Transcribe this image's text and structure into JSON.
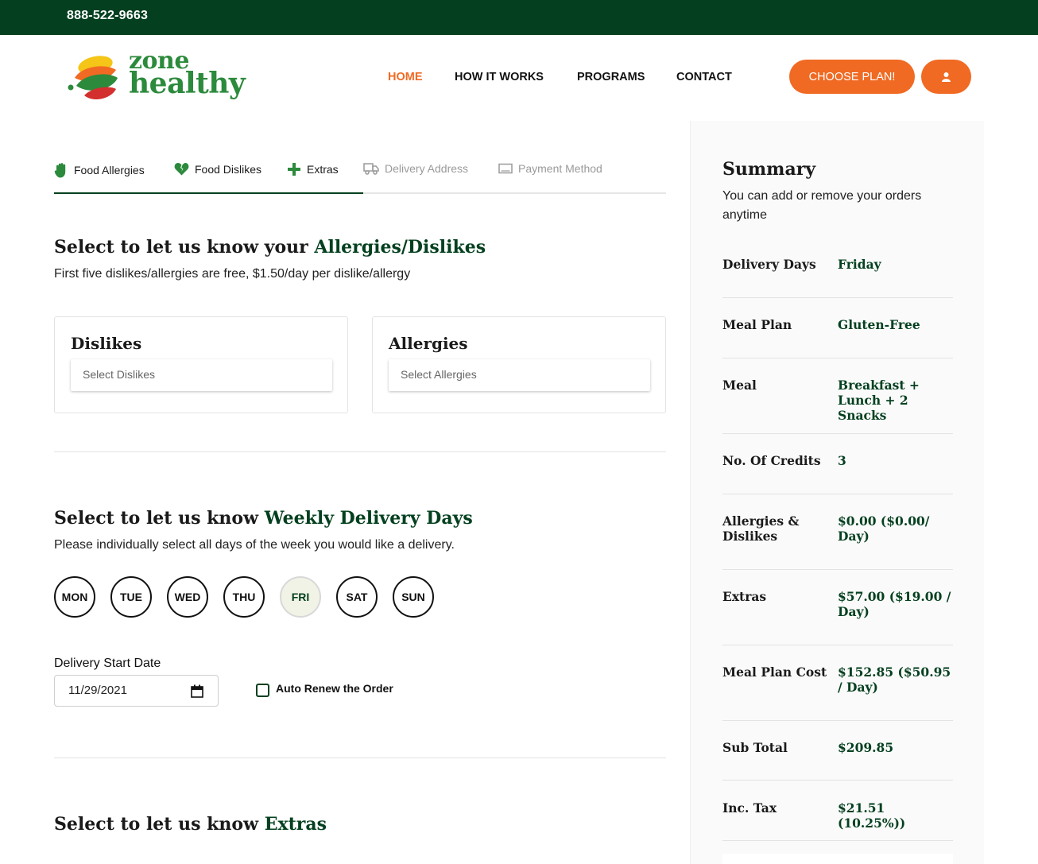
{
  "topbar": {
    "phone": "888-522-9663"
  },
  "header": {
    "logo": {
      "line1": "zone",
      "line2": "healthy"
    },
    "nav": [
      {
        "label": "HOME",
        "active": true
      },
      {
        "label": "HOW IT WORKS",
        "active": false
      },
      {
        "label": "PROGRAMS",
        "active": false
      },
      {
        "label": "CONTACT",
        "active": false
      }
    ],
    "cta_label": "CHOOSE PLAN!",
    "user_icon": "user-icon"
  },
  "colors": {
    "brand_dark": "#04401f",
    "accent": "#f06a23",
    "logo_green": "#2c8a3c"
  },
  "tabs": [
    {
      "label": "Food Allergies",
      "icon": "hand-icon",
      "enabled": true
    },
    {
      "label": "Food Dislikes",
      "icon": "broken-heart-icon",
      "enabled": true
    },
    {
      "label": "Extras",
      "icon": "plus-icon",
      "enabled": true
    },
    {
      "label": "Delivery Address",
      "icon": "truck-icon",
      "enabled": false
    },
    {
      "label": "Payment Method",
      "icon": "card-icon",
      "enabled": false
    }
  ],
  "allergies_section": {
    "title_prefix": "Select to let us know your ",
    "title_highlight": "Allergies/Dislikes",
    "subtitle": "First five dislikes/allergies are free, $1.50/day per dislike/allergy",
    "dislikes": {
      "title": "Dislikes",
      "placeholder": "Select Dislikes"
    },
    "allergies": {
      "title": "Allergies",
      "placeholder": "Select Allergies"
    }
  },
  "delivery_section": {
    "title_prefix": "Select to let us know ",
    "title_highlight": "Weekly Delivery Days",
    "subtitle": "Please individually select all days of the week you would like a delivery.",
    "days": [
      {
        "label": "MON",
        "selected": false
      },
      {
        "label": "TUE",
        "selected": false
      },
      {
        "label": "WED",
        "selected": false
      },
      {
        "label": "THU",
        "selected": false
      },
      {
        "label": "FRI",
        "selected": true
      },
      {
        "label": "SAT",
        "selected": false
      },
      {
        "label": "SUN",
        "selected": false
      }
    ],
    "start_date_label": "Delivery Start Date",
    "start_date_value": "11/29/2021",
    "auto_renew_label": "Auto Renew the Order",
    "auto_renew_checked": false
  },
  "extras_section": {
    "title_prefix": "Select to let us know ",
    "title_highlight": "Extras"
  },
  "summary": {
    "title": "Summary",
    "description": "You can add or remove your orders anytime",
    "rows": [
      {
        "key": "Delivery Days",
        "value": "Friday"
      },
      {
        "key": "Meal Plan",
        "value": "Gluten-Free"
      },
      {
        "key": "Meal",
        "value": "Breakfast + Lunch + 2 Snacks"
      },
      {
        "key": "No. Of Credits",
        "value": "3"
      },
      {
        "key": "Allergies & Dislikes",
        "value": "$0.00 ($0.00/ Day)"
      },
      {
        "key": "Extras",
        "value": "$57.00 ($19.00 / Day)"
      },
      {
        "key": "Meal Plan Cost",
        "value": "$152.85 ($50.95 / Day)"
      },
      {
        "key": "Sub Total",
        "value": "$209.85"
      },
      {
        "key": "Inc. Tax",
        "value": "$21.51 (10.25%))"
      }
    ]
  }
}
